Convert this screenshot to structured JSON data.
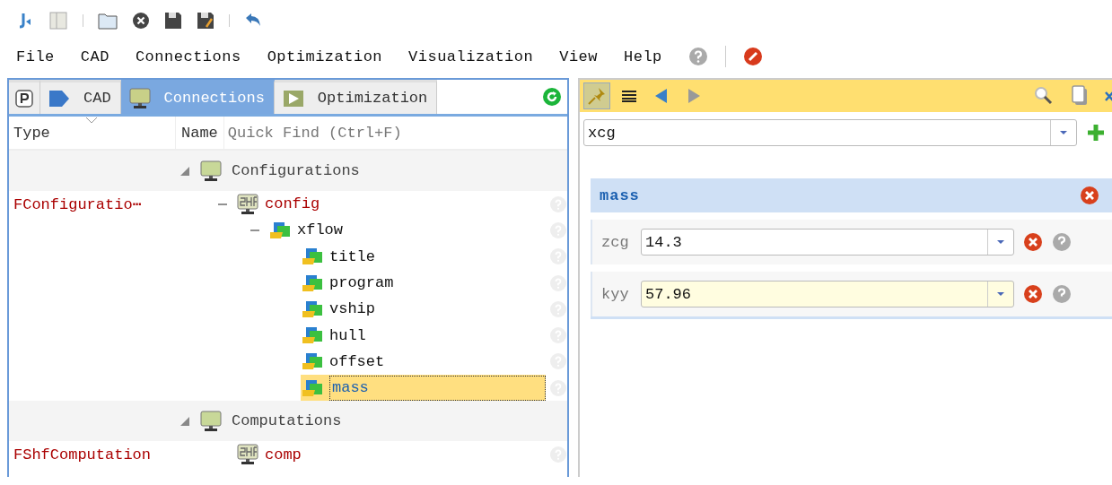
{
  "menu": [
    "File",
    "CAD",
    "Connections",
    "Optimization",
    "Visualization",
    "View",
    "Help"
  ],
  "left_panel": {
    "tabs": [
      {
        "kind": "project",
        "selected": false
      },
      {
        "label": "CAD",
        "kind": "cad",
        "selected": false
      },
      {
        "label": "Connections",
        "kind": "connections",
        "selected": true
      },
      {
        "label": "Optimization",
        "kind": "optimization",
        "selected": false
      }
    ],
    "columns": [
      "Type",
      "Name"
    ],
    "quick_find": {
      "placeholder": "Quick Find (Ctrl+F)"
    },
    "groups": [
      {
        "label": "Configurations",
        "expanded": true,
        "rows": [
          {
            "type": "FConfiguratio⋯",
            "name": "config",
            "kind": "component",
            "expanded": true,
            "selected": false,
            "children": [
              {
                "name": "xflow",
                "kind": "parameter",
                "expanded": true,
                "selected": false,
                "children": [
                  {
                    "name": "title",
                    "kind": "parameter",
                    "selected": false
                  },
                  {
                    "name": "program",
                    "kind": "parameter",
                    "selected": false
                  },
                  {
                    "name": "vship",
                    "kind": "parameter",
                    "selected": false
                  },
                  {
                    "name": "hull",
                    "kind": "parameter",
                    "selected": false
                  },
                  {
                    "name": "offset",
                    "kind": "parameter",
                    "selected": false
                  },
                  {
                    "name": "mass",
                    "kind": "parameter",
                    "selected": true
                  }
                ]
              }
            ]
          }
        ]
      },
      {
        "label": "Computations",
        "expanded": true,
        "rows": [
          {
            "type": "FShfComputation",
            "name": "comp",
            "kind": "component",
            "selected": false
          }
        ]
      }
    ]
  },
  "right_panel": {
    "toolbar": [
      {
        "kind": "pin",
        "pressed": true
      },
      {
        "kind": "list",
        "pressed": false
      },
      {
        "kind": "back",
        "pressed": false
      },
      {
        "kind": "forward",
        "pressed": false
      }
    ],
    "combo": {
      "value": "xcg"
    },
    "section": {
      "title": "mass",
      "fields": [
        {
          "label": "zcg",
          "value": "14.3",
          "modified": false
        },
        {
          "label": "kyy",
          "value": "57.96",
          "modified": true
        }
      ]
    }
  }
}
